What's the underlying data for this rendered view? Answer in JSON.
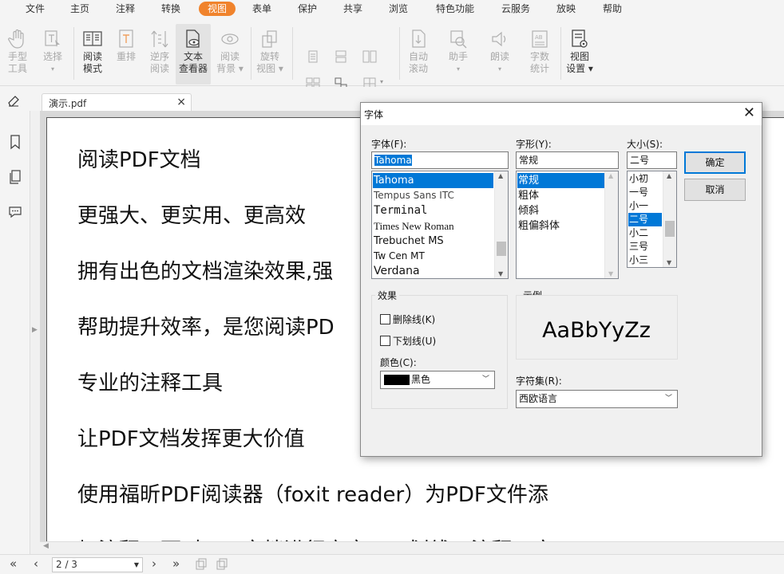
{
  "menu": [
    "文件",
    "主页",
    "注释",
    "转换",
    "视图",
    "表单",
    "保护",
    "共享",
    "浏览",
    "特色功能",
    "云服务",
    "放映",
    "帮助"
  ],
  "ribbon": {
    "hand": [
      "手型",
      "工具"
    ],
    "select": [
      "选择"
    ],
    "read_mode": [
      "阅读",
      "模式"
    ],
    "reflow": [
      "重排"
    ],
    "reverse": [
      "逆序",
      "阅读"
    ],
    "text_viewer": [
      "文本",
      "查看器"
    ],
    "read_bg": [
      "阅读",
      "背景"
    ],
    "rotate": [
      "旋转",
      "视图"
    ],
    "auto_scroll": [
      "自动",
      "滚动"
    ],
    "assistant": [
      "助手"
    ],
    "read_aloud": [
      "朗读"
    ],
    "word_count": [
      "字数",
      "统计"
    ],
    "view_settings": [
      "视图",
      "设置"
    ]
  },
  "tab": {
    "name": "演示.pdf",
    "close": "×"
  },
  "document_lines": [
    "阅读PDF文档",
    "更强大、更实用、更高效",
    "拥有出色的文档渲染效果,强",
    "帮助提升效率，是您阅读PD",
    "专业的注释工具",
    "让PDF文档发挥更大价值",
    "使用福昕PDF阅读器（foxit reader）为PDF文件添",
    "加注释，可对PDF文档进行高亮、下划线、注释、文"
  ],
  "nav": {
    "page": "2 / 3"
  },
  "dialog": {
    "title": "字体",
    "close": "✕",
    "font_label": "字体(F):",
    "font_value": "Tahoma",
    "fonts": [
      "Tahoma",
      "Tempus Sans ITC",
      "Terminal",
      "Times New Roman",
      "Trebuchet MS",
      "Tw Cen MT",
      "Verdana"
    ],
    "style_label": "字形(Y):",
    "style_value": "常规",
    "styles": [
      "常规",
      "粗体",
      "倾斜",
      "粗偏斜体"
    ],
    "size_label": "大小(S):",
    "size_value": "二号",
    "sizes": [
      "小初",
      "一号",
      "小一",
      "二号",
      "小二",
      "三号",
      "小三"
    ],
    "ok": "确定",
    "cancel": "取消",
    "effects_label": "效果",
    "strike": "删除线(K)",
    "underline": "下划线(U)",
    "color_label": "颜色(C):",
    "color_value": "黑色",
    "color_swatch": "#000000",
    "sample_label": "示例",
    "sample_text": "AaBbYyZz",
    "charset_label": "字符集(R):",
    "charset_value": "西欧语言"
  }
}
